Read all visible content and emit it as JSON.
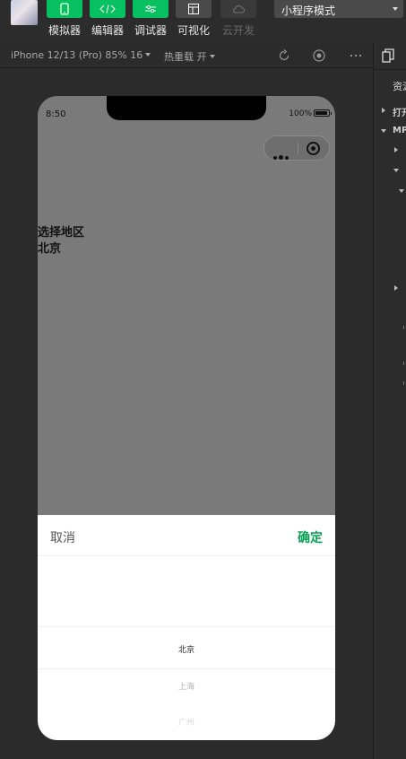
{
  "toolbar": {
    "tools": [
      {
        "label": "模拟器",
        "icon": "phone-icon"
      },
      {
        "label": "编辑器",
        "icon": "code-icon"
      },
      {
        "label": "调试器",
        "icon": "sliders-icon"
      },
      {
        "label": "可视化",
        "icon": "layout-icon"
      },
      {
        "label": "云开发",
        "icon": "cloud-icon"
      }
    ],
    "mode_select": "小程序模式"
  },
  "subbar": {
    "device": "iPhone 12/13 (Pro) 85% 16",
    "hot_reload": "热重载 开"
  },
  "phone": {
    "status_time": "8:50",
    "battery": "100%",
    "page_label": "选择地区",
    "page_value": "北京"
  },
  "picker": {
    "cancel": "取消",
    "confirm": "确定",
    "options": [
      "北京",
      "上海",
      "广州"
    ],
    "selected": "北京"
  },
  "right_panel": {
    "resources_label": "资源",
    "rows": [
      "打开",
      "MP"
    ]
  },
  "colors": {
    "accent_green": "#07c160",
    "confirm_green": "#07a354",
    "background": "#2b2b2b"
  }
}
